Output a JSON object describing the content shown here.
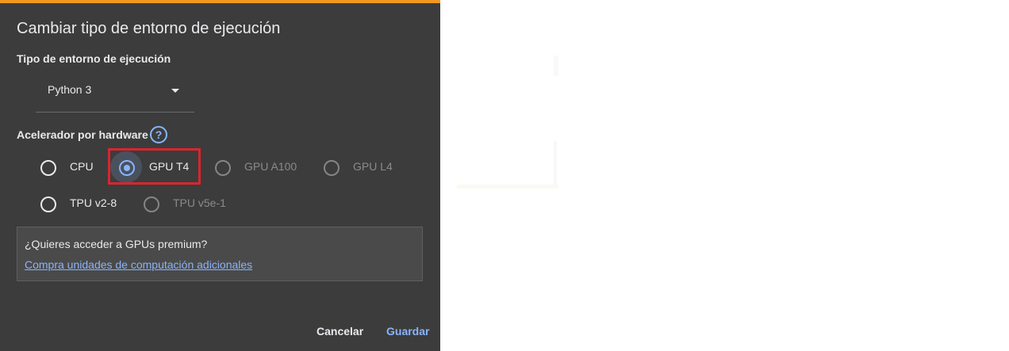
{
  "accent_colors": {
    "topbar": "#f19920",
    "link": "#8ab4f8",
    "highlight": "#d9252f"
  },
  "dialog": {
    "title": "Cambiar tipo de entorno de ejecución",
    "runtime_type": {
      "label": "Tipo de entorno de ejecución",
      "selected": "Python 3"
    },
    "hardware": {
      "label": "Acelerador por hardware",
      "help_icon": "question-circle-icon",
      "options": [
        {
          "label": "CPU",
          "checked": false,
          "disabled": false
        },
        {
          "label": "GPU T4",
          "checked": true,
          "disabled": false
        },
        {
          "label": "GPU A100",
          "checked": false,
          "disabled": true
        },
        {
          "label": "GPU L4",
          "checked": false,
          "disabled": true
        },
        {
          "label": "TPU v2-8",
          "checked": false,
          "disabled": false
        },
        {
          "label": "TPU v5e-1",
          "checked": false,
          "disabled": true
        }
      ]
    },
    "premium": {
      "question": "¿Quieres acceder a GPUs premium?",
      "link": "Compra unidades de computación adicionales"
    },
    "buttons": {
      "cancel": "Cancelar",
      "save": "Guardar"
    }
  }
}
